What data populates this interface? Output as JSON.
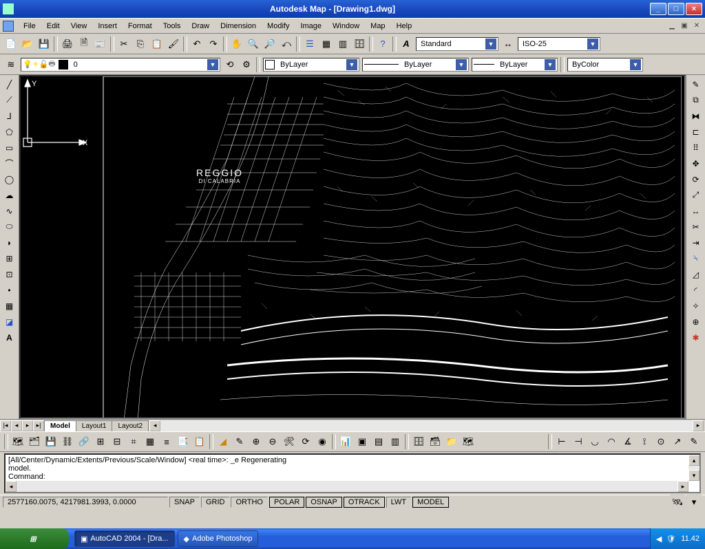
{
  "title": "Autodesk Map - [Drawing1.dwg]",
  "menu": [
    "File",
    "Edit",
    "View",
    "Insert",
    "Format",
    "Tools",
    "Draw",
    "Dimension",
    "Modify",
    "Image",
    "Window",
    "Map",
    "Help"
  ],
  "style_combo": "Standard",
  "dimstyle_combo": "ISO-25",
  "layer_combo": "0",
  "linetype_combo": "ByLayer",
  "lineweight_combo": "ByLayer",
  "linetype2_combo": "ByLayer",
  "plotstyle_combo": "ByColor",
  "tabs": {
    "model": "Model",
    "layout1": "Layout1",
    "layout2": "Layout2"
  },
  "ucs": {
    "x": "X",
    "y": "Y"
  },
  "map_label": {
    "line1": "REGGIO",
    "line2": "DI CALABRIA"
  },
  "command_lines": [
    "[All/Center/Dynamic/Extents/Previous/Scale/Window] <real time>: _e Regenerating",
    "model.",
    "Command:"
  ],
  "status": {
    "coords": "2577160.0075, 4217981.3993, 0.0000",
    "toggles": [
      "SNAP",
      "GRID",
      "ORTHO",
      "POLAR",
      "OSNAP",
      "OTRACK",
      "LWT",
      "MODEL"
    ]
  },
  "taskbar": {
    "apps": [
      "AutoCAD 2004 - [Dra...",
      "Adobe Photoshop"
    ],
    "clock": "11.42"
  }
}
